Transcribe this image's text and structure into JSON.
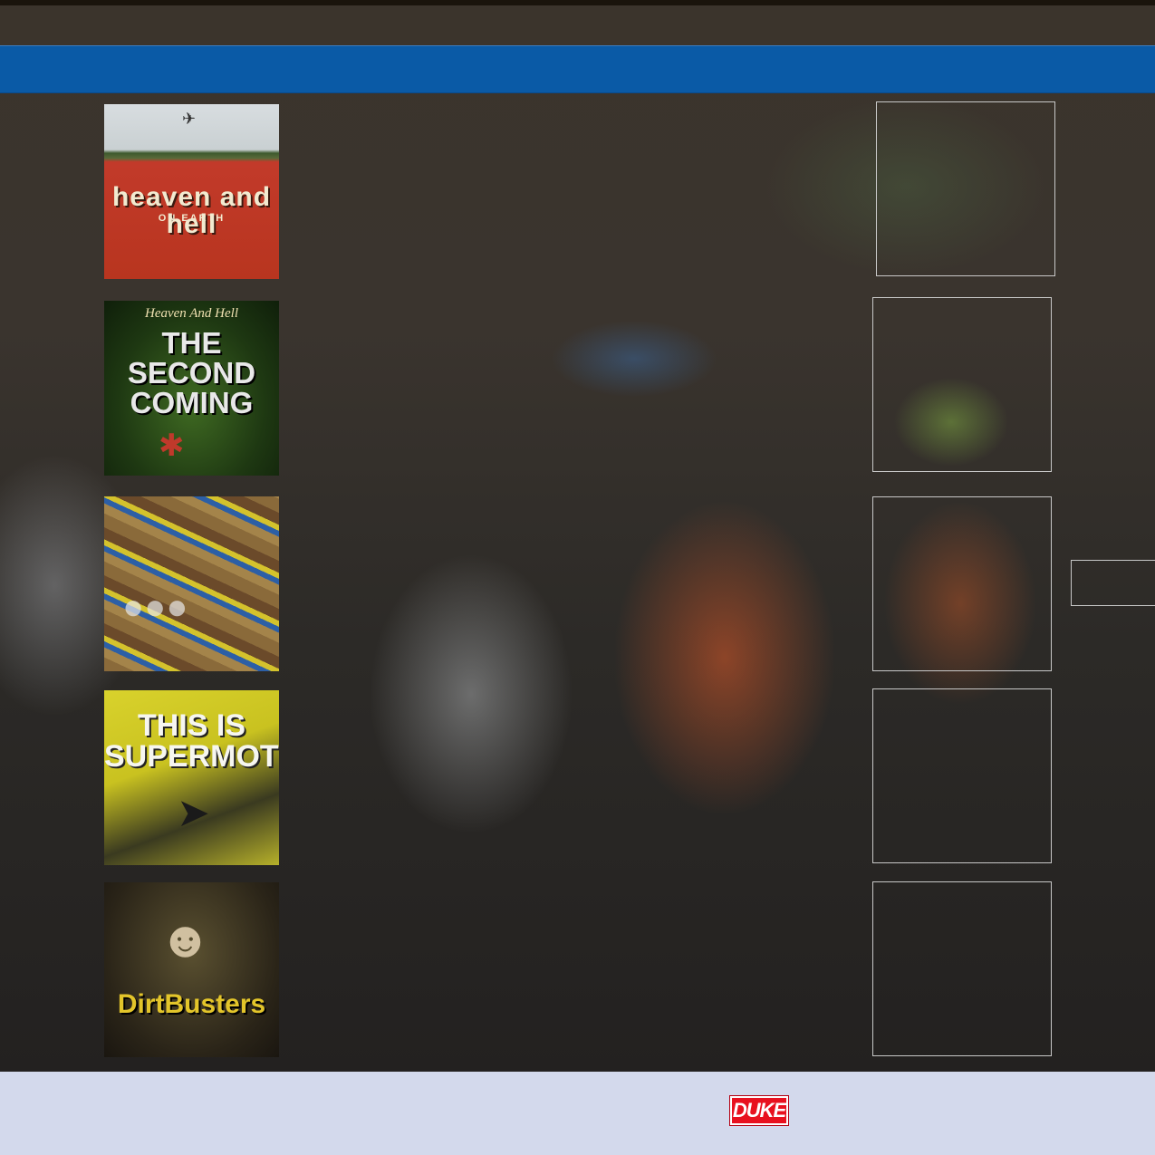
{
  "covers": [
    {
      "title": "heaven and hell",
      "subtitle": "ON EARTH",
      "icon": "motocross-rider-icon"
    },
    {
      "tagline": "Heaven And Hell",
      "title": "THE SECOND COMING",
      "icon": "rider-icon"
    },
    {
      "title": "",
      "icon": "dirt-bikes-lineup-icon"
    },
    {
      "title": "THIS IS SUPERMOTO",
      "icon": "rider-icon"
    },
    {
      "title": "DirtBusters",
      "icon": "rider-icon"
    }
  ],
  "footer": {
    "logo_text": "DUKE",
    "logo_color": "#e8111f"
  },
  "colors": {
    "banner": "#0a5aa6",
    "footer": "#d3d9ec"
  }
}
